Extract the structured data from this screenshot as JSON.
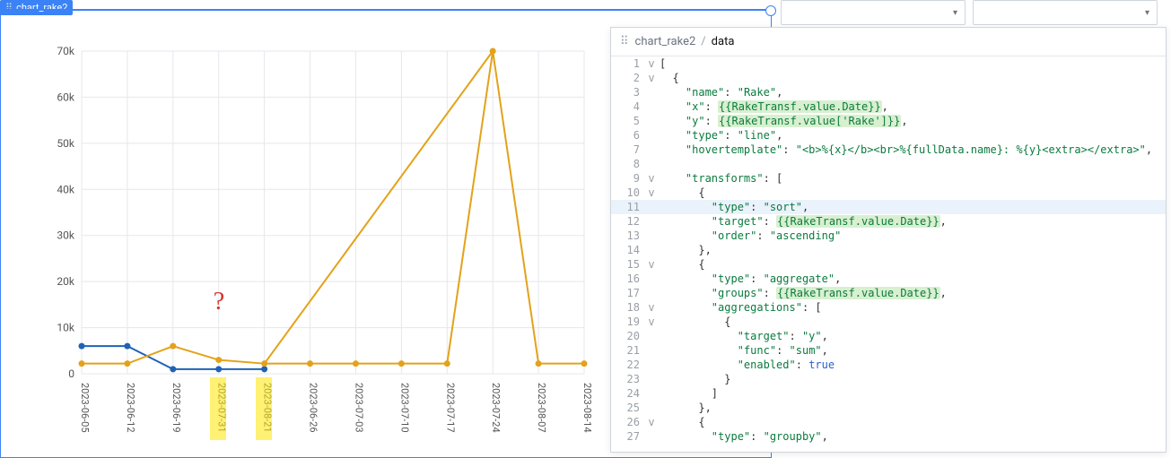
{
  "chart_tab_label": "chart_rake2",
  "question_mark": "?",
  "chart_data": {
    "type": "line",
    "title": "",
    "xlabel": "",
    "ylabel": "",
    "ylim": [
      0,
      70000
    ],
    "y_ticks": [
      0,
      10000,
      20000,
      30000,
      40000,
      50000,
      60000,
      70000
    ],
    "y_tick_labels": [
      "0",
      "10k",
      "20k",
      "30k",
      "40k",
      "50k",
      "60k",
      "70k"
    ],
    "x_categories": [
      "2023-06-05",
      "2023-06-12",
      "2023-06-19",
      "2023-07-31",
      "2023-08-21",
      "2023-06-26",
      "2023-07-03",
      "2023-07-10",
      "2023-07-17",
      "2023-07-24",
      "2023-08-07",
      "2023-08-14"
    ],
    "series": [
      {
        "name": "blue",
        "color": "#1f62b6",
        "values": [
          6000,
          6000,
          1000,
          1000,
          1000,
          null,
          null,
          null,
          null,
          null,
          null,
          null
        ]
      },
      {
        "name": "orange",
        "color": "#e3a21a",
        "values": [
          2200,
          2200,
          6000,
          3000,
          2200,
          2200,
          2200,
          2200,
          2200,
          70000,
          2200,
          2200
        ]
      }
    ],
    "extra_segments": [
      {
        "series": "orange",
        "from_x": "2023-08-21",
        "from_y": 2200,
        "to_x": "2023-07-24",
        "to_y": 70000
      }
    ],
    "highlighted_x": [
      "2023-07-31",
      "2023-08-21"
    ]
  },
  "code_panel": {
    "breadcrumb": [
      "chart_rake2",
      "data"
    ],
    "current_line": 11,
    "lines": [
      {
        "n": 1,
        "fold": "v",
        "html": "<span class='p'>[</span>"
      },
      {
        "n": 2,
        "fold": "v",
        "html": "  <span class='p'>{</span>"
      },
      {
        "n": 3,
        "fold": "",
        "html": "    <span class='k'>\"name\"</span><span class='p'>: </span><span class='s'>\"Rake\"</span><span class='p'>,</span>"
      },
      {
        "n": 4,
        "fold": "",
        "html": "    <span class='k'>\"x\"</span><span class='p'>: </span><span class='tmpl'>{{RakeTransf.value.Date}}</span><span class='p'>,</span>"
      },
      {
        "n": 5,
        "fold": "",
        "html": "    <span class='k'>\"y\"</span><span class='p'>: </span><span class='tmpl'>{{RakeTransf.value['Rake']}}</span><span class='p'>,</span>"
      },
      {
        "n": 6,
        "fold": "",
        "html": "    <span class='k'>\"type\"</span><span class='p'>: </span><span class='s'>\"line\"</span><span class='p'>,</span>"
      },
      {
        "n": 7,
        "fold": "",
        "html": "    <span class='k'>\"hovertemplate\"</span><span class='p'>: </span><span class='s'>\"&lt;b&gt;%{x}&lt;/b&gt;&lt;br&gt;%{fullData.name}: %{y}&lt;extra&gt;&lt;/extra&gt;\"</span><span class='p'>,</span>"
      },
      {
        "n": 8,
        "fold": "",
        "html": ""
      },
      {
        "n": 9,
        "fold": "v",
        "html": "    <span class='k'>\"transforms\"</span><span class='p'>: [</span>"
      },
      {
        "n": 10,
        "fold": "v",
        "html": "      <span class='p'>{</span>"
      },
      {
        "n": 11,
        "fold": "",
        "html": "        <span class='k'>\"type\"</span><span class='p'>: </span><span class='s'>\"sort\"</span><span class='p'>,</span>"
      },
      {
        "n": 12,
        "fold": "",
        "html": "        <span class='k'>\"target\"</span><span class='p'>: </span><span class='tmpl'>{{RakeTransf.value.Date}}</span><span class='p'>,</span>"
      },
      {
        "n": 13,
        "fold": "",
        "html": "        <span class='k'>\"order\"</span><span class='p'>: </span><span class='s'>\"ascending\"</span>"
      },
      {
        "n": 14,
        "fold": "",
        "html": "      <span class='p'>},</span>"
      },
      {
        "n": 15,
        "fold": "v",
        "html": "      <span class='p'>{</span>"
      },
      {
        "n": 16,
        "fold": "",
        "html": "        <span class='k'>\"type\"</span><span class='p'>: </span><span class='s'>\"aggregate\"</span><span class='p'>,</span>"
      },
      {
        "n": 17,
        "fold": "",
        "html": "        <span class='k'>\"groups\"</span><span class='p'>: </span><span class='tmpl'>{{RakeTransf.value.Date}}</span><span class='p'>,</span>"
      },
      {
        "n": 18,
        "fold": "v",
        "html": "        <span class='k'>\"aggregations\"</span><span class='p'>: [</span>"
      },
      {
        "n": 19,
        "fold": "v",
        "html": "          <span class='p'>{</span>"
      },
      {
        "n": 20,
        "fold": "",
        "html": "            <span class='k'>\"target\"</span><span class='p'>: </span><span class='s'>\"y\"</span><span class='p'>,</span>"
      },
      {
        "n": 21,
        "fold": "",
        "html": "            <span class='k'>\"func\"</span><span class='p'>: </span><span class='s'>\"sum\"</span><span class='p'>,</span>"
      },
      {
        "n": 22,
        "fold": "",
        "html": "            <span class='k'>\"enabled\"</span><span class='p'>: </span><span class='b'>true</span>"
      },
      {
        "n": 23,
        "fold": "",
        "html": "          <span class='p'>}</span>"
      },
      {
        "n": 24,
        "fold": "",
        "html": "        <span class='p'>]</span>"
      },
      {
        "n": 25,
        "fold": "",
        "html": "      <span class='p'>},</span>"
      },
      {
        "n": 26,
        "fold": "v",
        "html": "      <span class='p'>{</span>"
      },
      {
        "n": 27,
        "fold": "",
        "html": "        <span class='k'>\"type\"</span><span class='p'>: </span><span class='s'>\"groupby\"</span><span class='p'>,</span>"
      }
    ]
  }
}
